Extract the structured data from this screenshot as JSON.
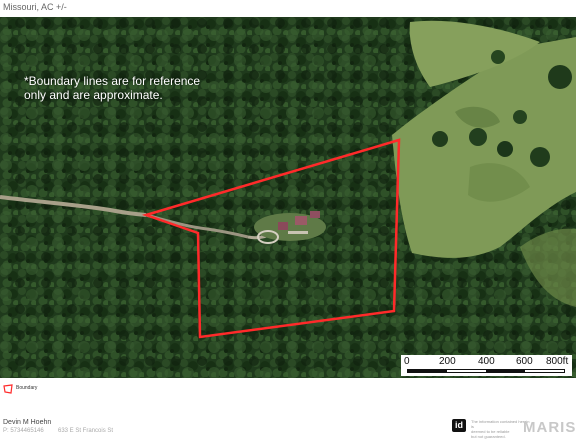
{
  "header": {
    "location_caption": "Missouri,  AC +/-"
  },
  "map": {
    "disclaimer": "*Boundary lines are for reference\nonly and are approximate.",
    "boundary_color": "#ff2a2a",
    "scale_bar": {
      "labels": [
        "0",
        "200",
        "400",
        "600",
        "800ft"
      ]
    }
  },
  "legend": {
    "label": "Boundary",
    "icon": "boundary-polygon-icon"
  },
  "footer": {
    "agent_name": "Devin M Hoehn",
    "agent_detail": "P: 5734465146",
    "office_detail": "633 E St Francois St",
    "badge": "id",
    "notice": "The information contained herein is\ndeemed to be reliable\nbut not guaranteed.",
    "brand": "MARIS"
  }
}
